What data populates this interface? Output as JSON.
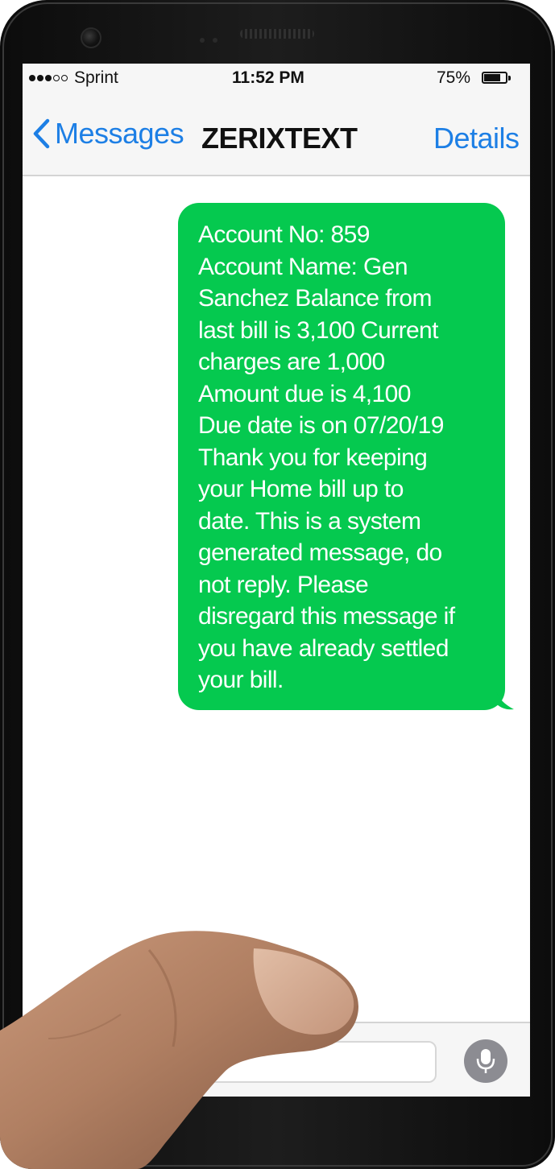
{
  "status_bar": {
    "carrier": "Sprint",
    "signal_bars_filled": 3,
    "signal_bars_total": 5,
    "time": "11:52 PM",
    "battery_percent": "75%",
    "battery_level": 0.75
  },
  "nav": {
    "back_label": "Messages",
    "title": "ZERIXTEXT",
    "details_label": "Details"
  },
  "message": {
    "lines": [
      "Account No: 859",
      "Account Name: Gen",
      "Sanchez Balance from",
      "last bill is 3,100 Current",
      "charges are 1,000",
      "Amount due is 4,100",
      "Due date is on 07/20/19",
      "Thank you for keeping",
      "your Home bill up to",
      "date. This is a system",
      "generated message, do",
      "not reply. Please",
      "disregard this message if",
      "you have already settled",
      "your bill."
    ]
  },
  "colors": {
    "bubble": "#05c94f",
    "link_blue": "#1d7fe5",
    "bar_bg": "#f6f6f6"
  },
  "icons": {
    "back": "chevron-left-icon",
    "mic": "microphone-icon",
    "battery": "battery-icon"
  }
}
